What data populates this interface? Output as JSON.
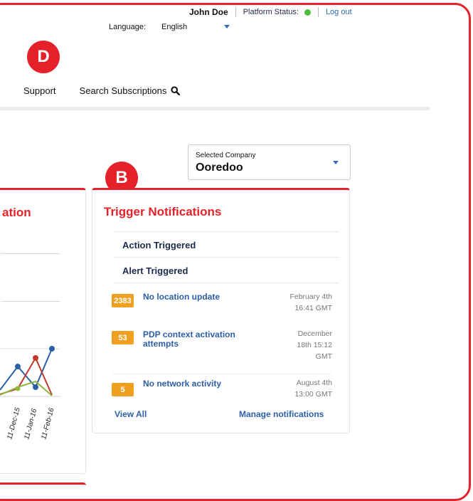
{
  "header": {
    "user_name": "John Doe",
    "platform_status_label": "Platform Status:",
    "platform_status_color": "#4cbf3a",
    "logout_label": "Log out",
    "language_label": "Language:",
    "language_value": "English"
  },
  "badges": {
    "top": "D",
    "panel": "B"
  },
  "nav": {
    "support_label": "Support",
    "search_label": "Search Subscriptions"
  },
  "company_selector": {
    "label": "Selected Company",
    "value": "Ooredoo"
  },
  "left_panel": {
    "title_fragment": "ation",
    "x_tick_labels": [
      "11-Dec-15",
      "11-Jan-16",
      "11-Feb-16"
    ]
  },
  "trigger_panel": {
    "title": "Trigger Notifications",
    "tabs": [
      "Action Triggered",
      "Alert Triggered"
    ],
    "notifications": [
      {
        "count": "2383",
        "title": "No location update",
        "date_lines": [
          "February 4th",
          "16:41 GMT"
        ]
      },
      {
        "count": "53",
        "title": "PDP context activation attempts",
        "date_lines": [
          "December",
          "18th 15:12",
          "GMT"
        ]
      },
      {
        "count": "5",
        "title": "No network activity",
        "date_lines": [
          "August 4th",
          "13:00 GMT"
        ]
      }
    ],
    "view_all_label": "View All",
    "manage_label": "Manage notifications"
  },
  "colors": {
    "brand_red": "#e52229",
    "count_badge": "#f0a020",
    "link_blue": "#2c5fa8",
    "navy": "#1b2b4d"
  }
}
